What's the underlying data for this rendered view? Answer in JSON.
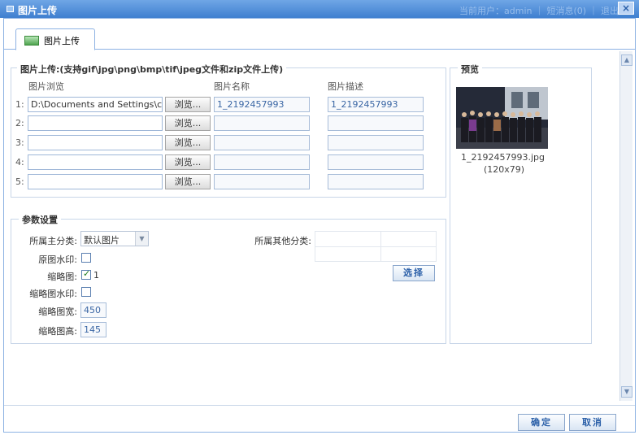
{
  "titlebar": {
    "title": "图片上传",
    "user_info": "当前用户：admin ｜ 短消息(0) ｜ 退出",
    "close_label": "×"
  },
  "tab": {
    "label": "图片上传"
  },
  "upload_section": {
    "legend": "图片上传:(支持gif\\jpg\\png\\bmp\\tif\\jpeg文件和zip文件上传)",
    "headers": {
      "browse": "图片浏览",
      "name": "图片名称",
      "desc": "图片描述"
    },
    "browse_label": "浏览...",
    "rows": [
      {
        "num": "1:",
        "path": "D:\\Documents and Settings\\ch",
        "name": "1_2192457993",
        "desc": "1_2192457993"
      },
      {
        "num": "2:",
        "path": "",
        "name": "",
        "desc": ""
      },
      {
        "num": "3:",
        "path": "",
        "name": "",
        "desc": ""
      },
      {
        "num": "4:",
        "path": "",
        "name": "",
        "desc": ""
      },
      {
        "num": "5:",
        "path": "",
        "name": "",
        "desc": ""
      }
    ]
  },
  "params": {
    "legend": "参数设置",
    "main_category_label": "所属主分类:",
    "main_category_value": "默认图片",
    "other_category_label": "所属其他分类:",
    "select_button": "选择",
    "watermark_label": "原图水印:",
    "watermark_checked": false,
    "thumb_label": "缩略图:",
    "thumb_checked": true,
    "thumb_value": "1",
    "thumb_watermark_label": "缩略图水印:",
    "thumb_watermark_checked": false,
    "thumb_width_label": "缩略图宽:",
    "thumb_width_value": "450",
    "thumb_height_label": "缩略图高:",
    "thumb_height_value": "145"
  },
  "preview": {
    "legend": "预览",
    "filename": "1_2192457993.jpg",
    "dims": "(120x79)"
  },
  "footer": {
    "ok_label": "确定",
    "cancel_label": "取消"
  }
}
